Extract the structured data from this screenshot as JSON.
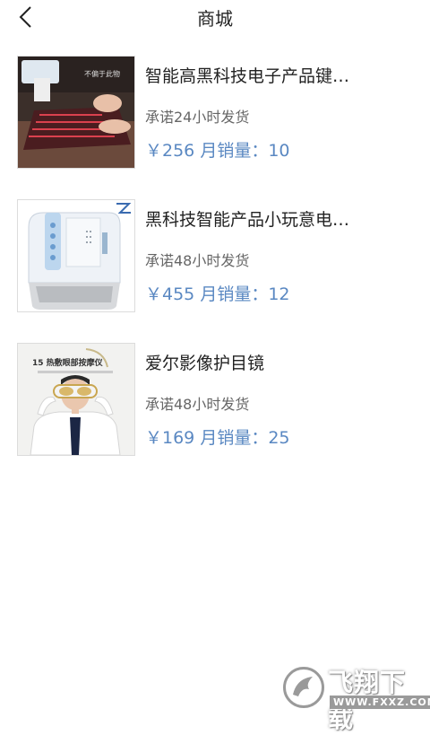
{
  "header": {
    "title": "商城",
    "back_icon": "chevron-left-icon"
  },
  "products": [
    {
      "name": "智能高黑科技电子产品键…",
      "ship": "承诺24小时发货",
      "price": "￥256",
      "sales_label": "月销量：",
      "sales": "10",
      "thumb_caption": "不偏于此物"
    },
    {
      "name": "黑科技智能产品小玩意电…",
      "ship": "承诺48小时发货",
      "price": "￥455",
      "sales_label": "月销量：",
      "sales": "12",
      "thumb_caption": ""
    },
    {
      "name": "爱尔影像护目镜",
      "ship": "承诺48小时发货",
      "price": "￥169",
      "sales_label": "月销量：",
      "sales": "25",
      "thumb_caption": "15 热敷眼部按摩仪"
    }
  ],
  "colors": {
    "price": "#5a88c2",
    "ship": "#666666",
    "title": "#222222"
  },
  "watermark": {
    "title": "飞翔下载",
    "url": "WWW.FXXZ.COM"
  }
}
